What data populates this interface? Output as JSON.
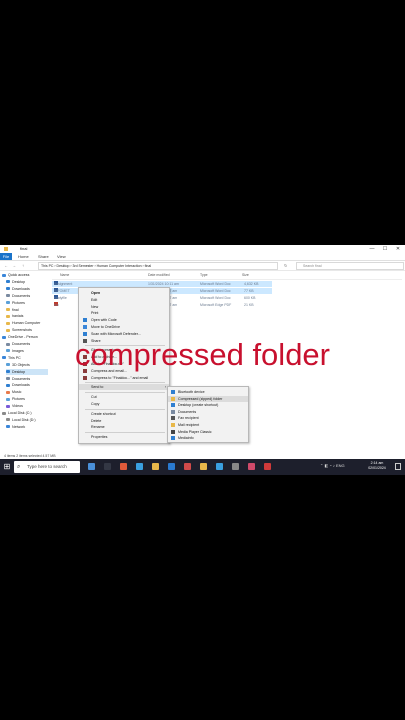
{
  "window": {
    "title": "final",
    "min": "—",
    "max": "☐",
    "close": "✕"
  },
  "ribbon": {
    "file": "File",
    "tabs": [
      "Home",
      "Share",
      "View"
    ]
  },
  "address": {
    "back": "←",
    "forward": "→",
    "up": "↑",
    "path": "This PC  ›  Desktop  ›  3rd Semester  ›  Human Computer Interaction  ›  final",
    "refresh": "↻",
    "search_placeholder": "Search final"
  },
  "sidebar": [
    {
      "label": "Quick access",
      "color": "#3a86d9"
    },
    {
      "label": "Desktop",
      "color": "#2f7fd1"
    },
    {
      "label": "Downloads",
      "color": "#2f7fd1"
    },
    {
      "label": "Documents",
      "color": "#7a8aa0"
    },
    {
      "label": "Pictures",
      "color": "#5aa0d8"
    },
    {
      "label": "final",
      "color": "#e8b84a"
    },
    {
      "label": "haniais",
      "color": "#e8b84a"
    },
    {
      "label": "Human Computer",
      "color": "#e8b84a"
    },
    {
      "label": "Screenshots",
      "color": "#e8b84a"
    },
    {
      "label": "OneDrive - Person",
      "color": "#3a86d9"
    },
    {
      "label": "Documents",
      "color": "#7a8aa0"
    },
    {
      "label": "Images",
      "color": "#5aa0d8"
    },
    {
      "label": "This PC",
      "color": "#3a86d9"
    },
    {
      "label": "3D Objects",
      "color": "#5aa0d8"
    },
    {
      "label": "Desktop",
      "color": "#2f7fd1"
    },
    {
      "label": "Documents",
      "color": "#7a8aa0"
    },
    {
      "label": "Downloads",
      "color": "#2f7fd1"
    },
    {
      "label": "Music",
      "color": "#e87a4a"
    },
    {
      "label": "Pictures",
      "color": "#5aa0d8"
    },
    {
      "label": "Videos",
      "color": "#7a5ad8"
    },
    {
      "label": "Local Disk (C:)",
      "color": "#8a8a8a"
    },
    {
      "label": "Local Disk (D:)",
      "color": "#8a8a8a"
    },
    {
      "label": "Network",
      "color": "#3a86d9"
    }
  ],
  "columns": {
    "name": "Name",
    "date": "Date modified",
    "type": "Type",
    "size": "Size"
  },
  "files": [
    {
      "name": "Assignment",
      "date": "1/31/2024 10:11 am",
      "type": "Microsoft Word Doc",
      "size": "4,632 KB",
      "color": "#2b5797",
      "selected": true
    },
    {
      "name": "INFOMET",
      "date": "1/31/2024 9:57 am",
      "type": "Microsoft Word Doc",
      "size": "77 KB",
      "color": "#2b5797",
      "selected": true
    },
    {
      "name": "studyfile",
      "date": "1/31/2024 9:57 am",
      "type": "Microsoft Word Doc",
      "size": "600 KB",
      "color": "#2b5797",
      "selected": false
    },
    {
      "name": "bio",
      "date": "1/31/2024 9:57 am",
      "type": "Microsoft Edge PDF",
      "size": "21 KB",
      "color": "#c0392b",
      "selected": false
    }
  ],
  "status": "4 items   2 items selected  4.57 MB",
  "context_menu": {
    "items": [
      {
        "label": "Open",
        "icon": "",
        "sep_after": false,
        "bold": true
      },
      {
        "label": "Edit",
        "icon": "",
        "sep_after": false
      },
      {
        "label": "New",
        "icon": "",
        "sep_after": false
      },
      {
        "label": "Print",
        "icon": "",
        "sep_after": false
      },
      {
        "label": "Open with Code",
        "icon": "#2f7fd1",
        "sep_after": false
      },
      {
        "label": "Move to OneDrive",
        "icon": "#3a86d9",
        "sep_after": false
      },
      {
        "label": "Scan with Microsoft Defender...",
        "icon": "#2f7fd1",
        "sep_after": false
      },
      {
        "label": "Share",
        "icon": "#555555",
        "sep_after": true
      },
      {
        "label": "Give access to",
        "icon": "",
        "sep_after": false
      },
      {
        "label": "Add to archive...",
        "icon": "#8a3a3a",
        "sep_after": false
      },
      {
        "label": "Add to \"Finaldoc.rar\"",
        "icon": "#8a3a3a",
        "sep_after": false
      },
      {
        "label": "Compress and email...",
        "icon": "#8a3a3a",
        "sep_after": false
      },
      {
        "label": "Compress to \"Finaldoc...\" and email",
        "icon": "#8a3a3a",
        "sep_after": true
      },
      {
        "label": "Send to",
        "icon": "",
        "sep_after": true,
        "arrow": "›",
        "highlight": true
      },
      {
        "label": "Cut",
        "icon": "",
        "sep_after": false
      },
      {
        "label": "Copy",
        "icon": "",
        "sep_after": true
      },
      {
        "label": "Create shortcut",
        "icon": "",
        "sep_after": false
      },
      {
        "label": "Delete",
        "icon": "",
        "sep_after": false
      },
      {
        "label": "Rename",
        "icon": "",
        "sep_after": true
      },
      {
        "label": "Properties",
        "icon": "",
        "sep_after": false
      }
    ]
  },
  "send_to_menu": [
    {
      "label": "Bluetooth device",
      "icon": "#2f7fd1"
    },
    {
      "label": "Compressed (zipped) folder",
      "icon": "#e8b84a",
      "highlight": true
    },
    {
      "label": "Desktop (create shortcut)",
      "icon": "#2f7fd1"
    },
    {
      "label": "Documents",
      "icon": "#7a8aa0"
    },
    {
      "label": "Fax recipient",
      "icon": "#555555"
    },
    {
      "label": "Mail recipient",
      "icon": "#e8b84a"
    },
    {
      "label": "Media Player Classic",
      "icon": "#444444"
    },
    {
      "label": "Mediainfo",
      "icon": "#2f7fd1"
    }
  ],
  "overlay_text": "compressed folder",
  "taskbar": {
    "start": "⊞",
    "search_icon": "⌕",
    "search_placeholder": "Type here to search",
    "apps": [
      "#4a90d9",
      "#333744",
      "#e05a3a",
      "#3aa0e0",
      "#e8b84a",
      "#2a7ad0",
      "#d04a4a",
      "#e8b84a",
      "#3aa0e0",
      "#888888",
      "#d04a6a",
      "#d03a3a"
    ],
    "tray": "⌃  ◧  ◔  ♪  ENG",
    "time": "2:14 am",
    "date": "02/01/2024"
  }
}
